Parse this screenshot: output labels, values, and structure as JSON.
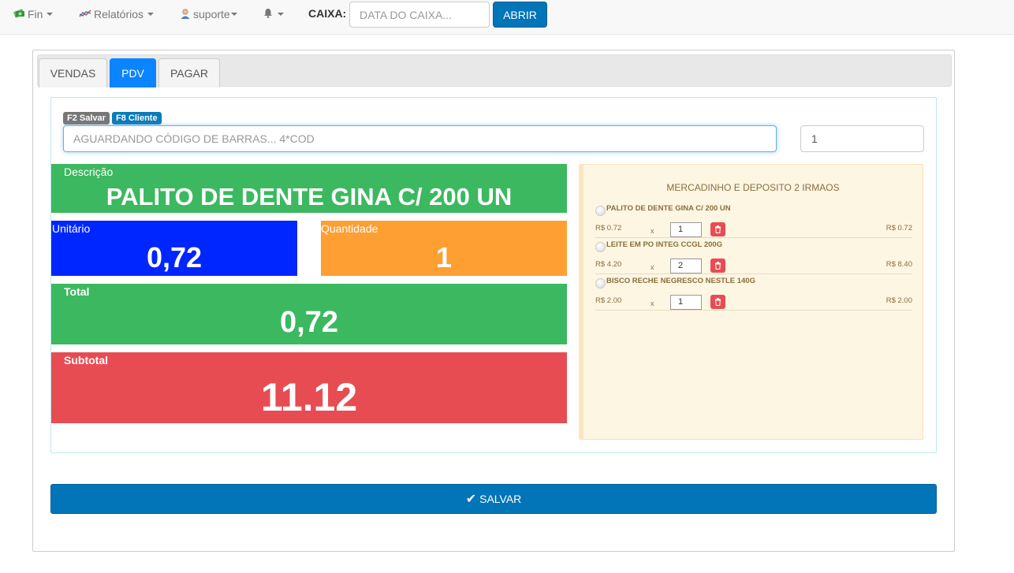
{
  "navbar": {
    "fin": "Fin",
    "relatorios": "Relatórios",
    "user": "suporte",
    "caixa_label": "CAIXA:",
    "caixa_placeholder": "DATA DO CAIXA...",
    "abrir": "ABRIR"
  },
  "tabs": [
    {
      "label": "VENDAS",
      "active": false
    },
    {
      "label": "PDV",
      "active": true
    },
    {
      "label": "PAGAR",
      "active": false
    }
  ],
  "shortcuts": {
    "save": "F2 Salvar",
    "client": "F8 Cliente"
  },
  "barcode": {
    "placeholder": "AGUARDANDO CÓDIGO DE BARRAS... 4*COD",
    "quantity": "1"
  },
  "product": {
    "desc_label": "Descrição",
    "description": "PALITO DE DENTE GINA C/ 200 UN",
    "unit_label": "Unitário",
    "unit": "0,72",
    "qty_label": "Quantidade",
    "qty": "1",
    "total_label": "Total",
    "total": "0,72",
    "subtotal_label": "Subtotal",
    "subtotal": "11.12"
  },
  "receipt": {
    "store": "MERCADINHO E DEPOSITO 2 IRMAOS",
    "items": [
      {
        "name": "PALITO DE DENTE GINA C/ 200 UN",
        "price": "R$ 0.72",
        "x": "x",
        "qty": "1",
        "total": "R$ 0.72"
      },
      {
        "name": "LEITE EM PO INTEG CCGL 200G",
        "price": "R$ 4.20",
        "x": "x",
        "qty": "2",
        "total": "R$ 8.40"
      },
      {
        "name": "BISCO RECHE NEGRESCO NESTLE 140G",
        "price": "R$ 2.00",
        "x": "x",
        "qty": "1",
        "total": "R$ 2.00"
      }
    ]
  },
  "save_button": "SALVAR",
  "colors": {
    "primary": "#0275b8",
    "active_tab": "#0a84ff",
    "green": "#3cb860",
    "blue": "#0026ff",
    "orange": "#fe9f33",
    "red": "#e84c53"
  }
}
